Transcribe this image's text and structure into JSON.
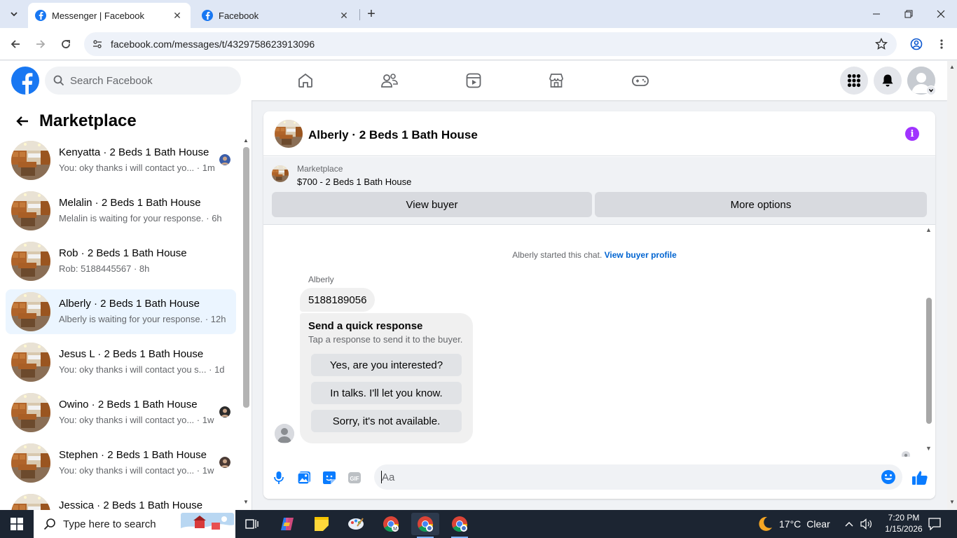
{
  "browser": {
    "tabs": [
      {
        "title": "Messenger | Facebook",
        "active": true
      },
      {
        "title": "Facebook",
        "active": false
      }
    ],
    "url": "facebook.com/messages/t/4329758623913096"
  },
  "fb": {
    "search_placeholder": "Search Facebook"
  },
  "sidebar": {
    "title": "Marketplace",
    "conversations": [
      {
        "name": "Kenyatta · 2 Beds 1 Bath House",
        "preview": "You: oky thanks i will contact yo... · 1m",
        "selected": false
      },
      {
        "name": "Melalin · 2 Beds 1 Bath House",
        "preview": "Melalin is waiting for your response. · 6h",
        "selected": false
      },
      {
        "name": "Rob · 2 Beds 1 Bath House",
        "preview": "Rob: 5188445567 · 8h",
        "selected": false
      },
      {
        "name": "Alberly · 2 Beds 1 Bath House",
        "preview": "Alberly is waiting for your response. · 12h",
        "selected": true
      },
      {
        "name": "Jesus L · 2 Beds 1 Bath House",
        "preview": "You: oky thanks i will contact you s... · 1d",
        "selected": false
      },
      {
        "name": "Owino · 2 Beds 1 Bath House",
        "preview": "You: oky thanks i will contact yo... · 1w",
        "selected": false
      },
      {
        "name": "Stephen · 2 Beds 1 Bath House",
        "preview": "You: oky thanks i will contact yo... · 1w",
        "selected": false
      },
      {
        "name": "Jessica · 2 Beds 1 Bath House",
        "preview": "",
        "selected": false
      }
    ]
  },
  "chat": {
    "title": "Alberly · 2 Beds 1 Bath House",
    "listing": {
      "source": "Marketplace",
      "price_title": "$700 - 2 Beds 1 Bath House",
      "view_buyer": "View buyer",
      "more_options": "More options"
    },
    "system_text": "Alberly started this chat.",
    "system_link": "View buyer profile",
    "sender": "Alberly",
    "message": "5188189056",
    "quick": {
      "title": "Send a quick response",
      "subtitle": "Tap a response to send it to the buyer.",
      "options": [
        "Yes, are you interested?",
        "In talks. I'll let you know.",
        "Sorry, it's not available."
      ]
    },
    "composer_placeholder": "Aa"
  },
  "taskbar": {
    "search": "Type here to search",
    "weather_temp": "17°C",
    "weather_cond": "Clear",
    "time": "7:20 PM",
    "date": "1/15/2026"
  },
  "colors": {
    "fb_blue": "#1877f2",
    "selected_bg": "#ebf5ff",
    "info_purple": "#a033ff",
    "link_blue": "#0064d1"
  }
}
